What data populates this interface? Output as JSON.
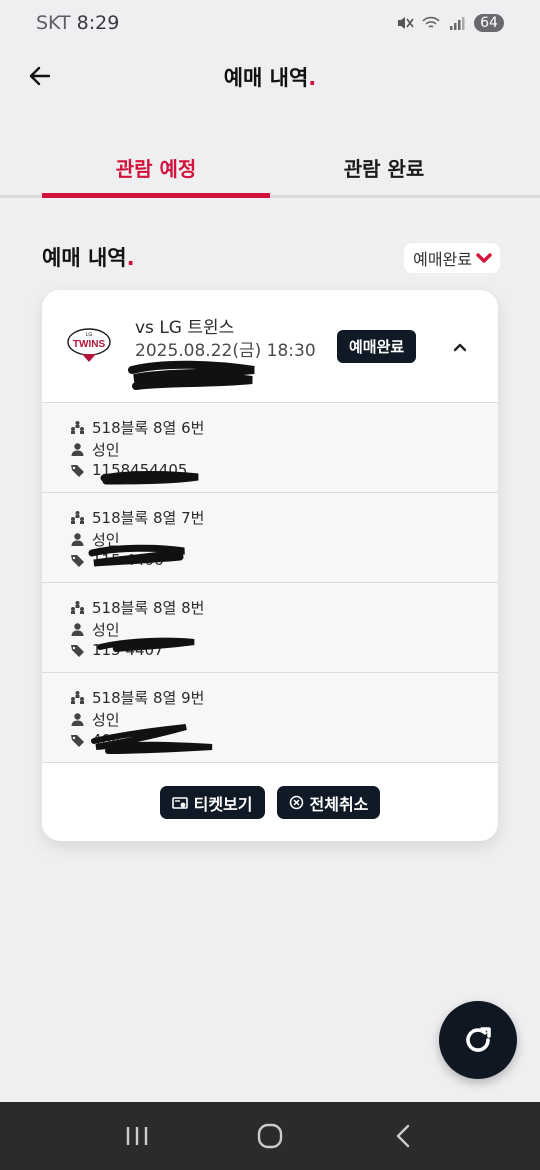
{
  "status_bar": {
    "carrier": "SKT",
    "time": "8:29",
    "battery": "64"
  },
  "header": {
    "title": "예매 내역",
    "title_dot": "."
  },
  "tabs": [
    {
      "label": "관람 예정",
      "active": true
    },
    {
      "label": "관람 완료",
      "active": false
    }
  ],
  "section": {
    "title": "예매 내역",
    "title_dot": ".",
    "filter_value": "예매완료"
  },
  "booking": {
    "team_logo_text": "TWINS",
    "team_logo_small": "LG",
    "opponent": "vs LG 트윈스",
    "datetime": "2025.08.22(금) 18:30",
    "status": "예매완료",
    "seats": [
      {
        "seat": "518블록 8열 6번",
        "type": "성인",
        "ticket_no": "1158454405"
      },
      {
        "seat": "518블록 8열 7번",
        "type": "성인",
        "ticket_no": "115  4406"
      },
      {
        "seat": "518블록 8열 8번",
        "type": "성인",
        "ticket_no": "115  4407"
      },
      {
        "seat": "518블록 8열 9번",
        "type": "성인",
        "ticket_no": "       408"
      }
    ],
    "view_ticket_label": "티켓보기",
    "cancel_all_label": "전체취소"
  },
  "colors": {
    "accent": "#d3123c",
    "dark": "#101a26",
    "background": "#efeff1"
  }
}
